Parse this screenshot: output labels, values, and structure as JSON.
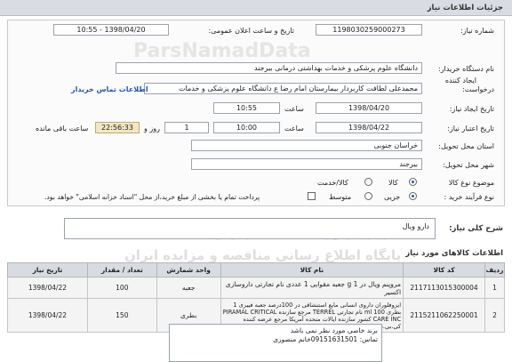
{
  "header": {
    "title": "جزئیات اطلاعات نیاز"
  },
  "form": {
    "need_number_label": "شماره نیاز:",
    "need_number": "1198030259000273",
    "announce_label": "تاریخ و ساعت اعلان عمومی:",
    "announce_value": "1398/04/20 - 10:55",
    "buyer_org_label": "نام دستگاه خریدار:",
    "buyer_org": "دانشگاه علوم پزشکی و خدمات بهداشتی درمانی بیرجند",
    "requester_label_1": "ایجاد کننده",
    "requester_label_2": "درخواست:",
    "requester": "محمدعلی لطافت کاربردار بیمارستان امام رضا ع دانشگاه علوم پزشکی و خدمات",
    "contact_link": "اطلاعات تماس خریدار",
    "create_date_label": "تاریخ ایجاد نیاز:",
    "create_date": "1398/04/20",
    "create_time_label": "ساعت",
    "create_time": "10:55",
    "deadline_label": "تاریخ اعتبار نیاز:",
    "deadline_date": "1398/04/22",
    "deadline_time_label": "ساعت",
    "deadline_time": "10:00",
    "days_value": "1",
    "days_label": "روز و",
    "remaining_time": "22:56:33",
    "remaining_label": "ساعت باقی مانده",
    "province_label": "استان محل تحویل:",
    "province": "خراسان جنوبی",
    "city_label": "شهر محل تحویل:",
    "city": "بیرجند",
    "subject_label": "موضوع نوع کالا",
    "subject_options": [
      "کالا",
      "کالا/خدمت"
    ],
    "purchase_type_label": "نوع فرآیند خرید :",
    "purchase_options": [
      "جزیی",
      "متوسط"
    ],
    "payment_note": "پرداخت تمام یا بخشی از مبلغ خرید،از محل \"اسناد خزانه اسلامی\" خواهد بود."
  },
  "description": {
    "label": "شرح کلی نیاز:",
    "value": "دارو ویال"
  },
  "items_section": {
    "title": "اطلاعات کالاهای مورد نیاز"
  },
  "table": {
    "headers": [
      "ردیف",
      "کد کالا",
      "نام کالا",
      "واحد شمارش",
      "تعداد / مقدار",
      "تاریخ نیاز"
    ],
    "rows": [
      {
        "index": "1",
        "code": "2117113015300004",
        "name": "مروپنم ویال در 1 g جعبه مقوایی 1 عددی نام تجارتی داروسازی اکسیر",
        "unit": "جعبه",
        "qty": "100",
        "date": "1398/04/22"
      },
      {
        "index": "2",
        "code": "2115211062250001",
        "name": "ایزوفلوران داروی انسانی مایع استنشاقی در 100درصد جعبه فیبری 1 بطری 100 ml نام تجارتی TERREL مرجع سازنده PIRAMAL CRITICAL CARE INC کشور سازنده ایالات متحده آمریکا مرجع عرضه کننده کی.بی.سی",
        "unit": "بطری",
        "qty": "150",
        "date": "1398/04/22"
      }
    ]
  },
  "buyer_notes": {
    "line1": "برند خاصی مورد نظر نمی باشد",
    "line2": "تماس: 09151631501خانم منصوری"
  },
  "watermark": {
    "line1": "مرکز فراوری اطلاعات پارس نماد داده ها",
    "line2": "پایگاه اطلاع رسانی مناقصه و مزایده ایران",
    "brand": "ParsNamadData"
  },
  "colors": {
    "header_bg": "#d9dde3",
    "timer_bg": "#f2e7c2",
    "link": "#2356b5"
  }
}
